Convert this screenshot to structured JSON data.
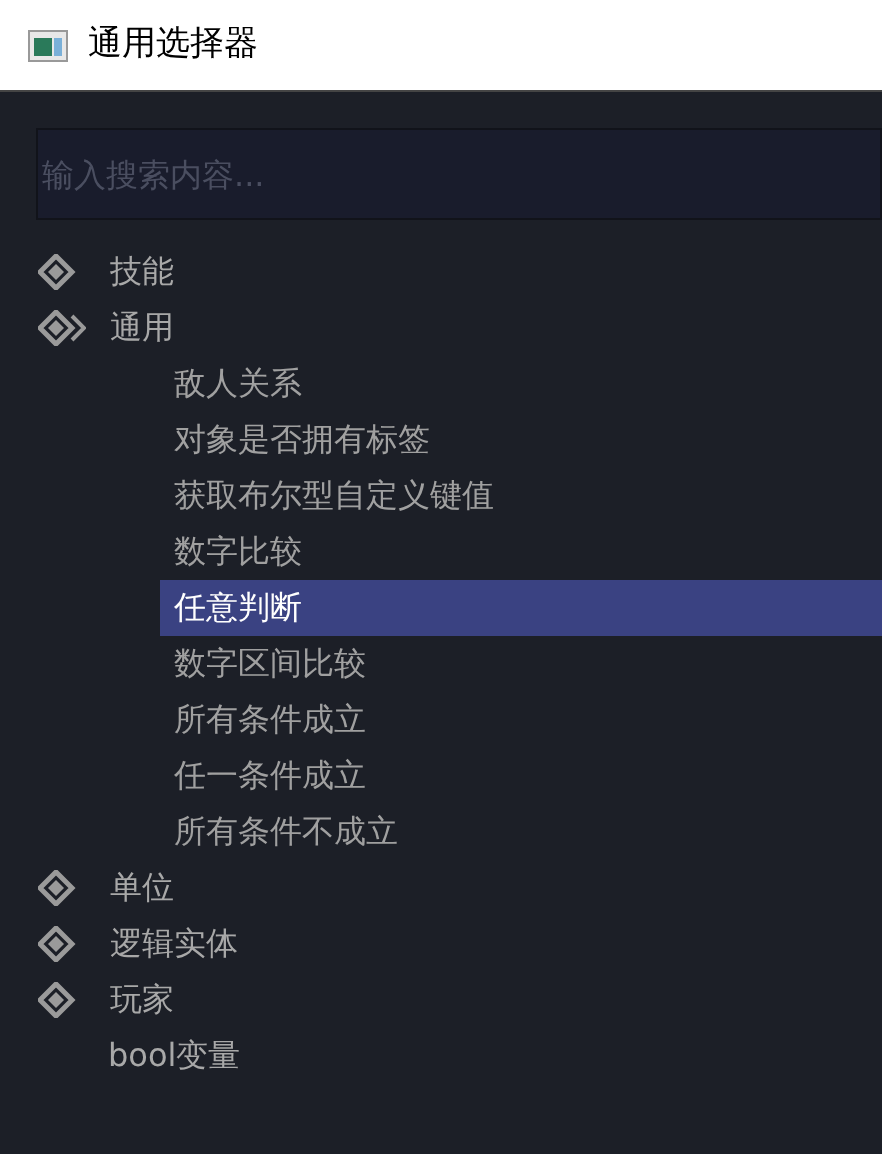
{
  "window": {
    "title": "通用选择器"
  },
  "search": {
    "placeholder": "输入搜索内容..."
  },
  "tree": [
    {
      "label": "技能",
      "expanded": false
    },
    {
      "label": "通用",
      "expanded": true,
      "children": [
        {
          "label": "敌人关系",
          "selected": false
        },
        {
          "label": "对象是否拥有标签",
          "selected": false
        },
        {
          "label": "获取布尔型自定义键值",
          "selected": false
        },
        {
          "label": "数字比较",
          "selected": false
        },
        {
          "label": "任意判断",
          "selected": true
        },
        {
          "label": "数字区间比较",
          "selected": false
        },
        {
          "label": "所有条件成立",
          "selected": false
        },
        {
          "label": "任一条件成立",
          "selected": false
        },
        {
          "label": "所有条件不成立",
          "selected": false
        }
      ]
    },
    {
      "label": "单位",
      "expanded": false
    },
    {
      "label": "逻辑实体",
      "expanded": false
    },
    {
      "label": "玩家",
      "expanded": false
    },
    {
      "label": "bool变量",
      "kind": "leaf"
    }
  ]
}
